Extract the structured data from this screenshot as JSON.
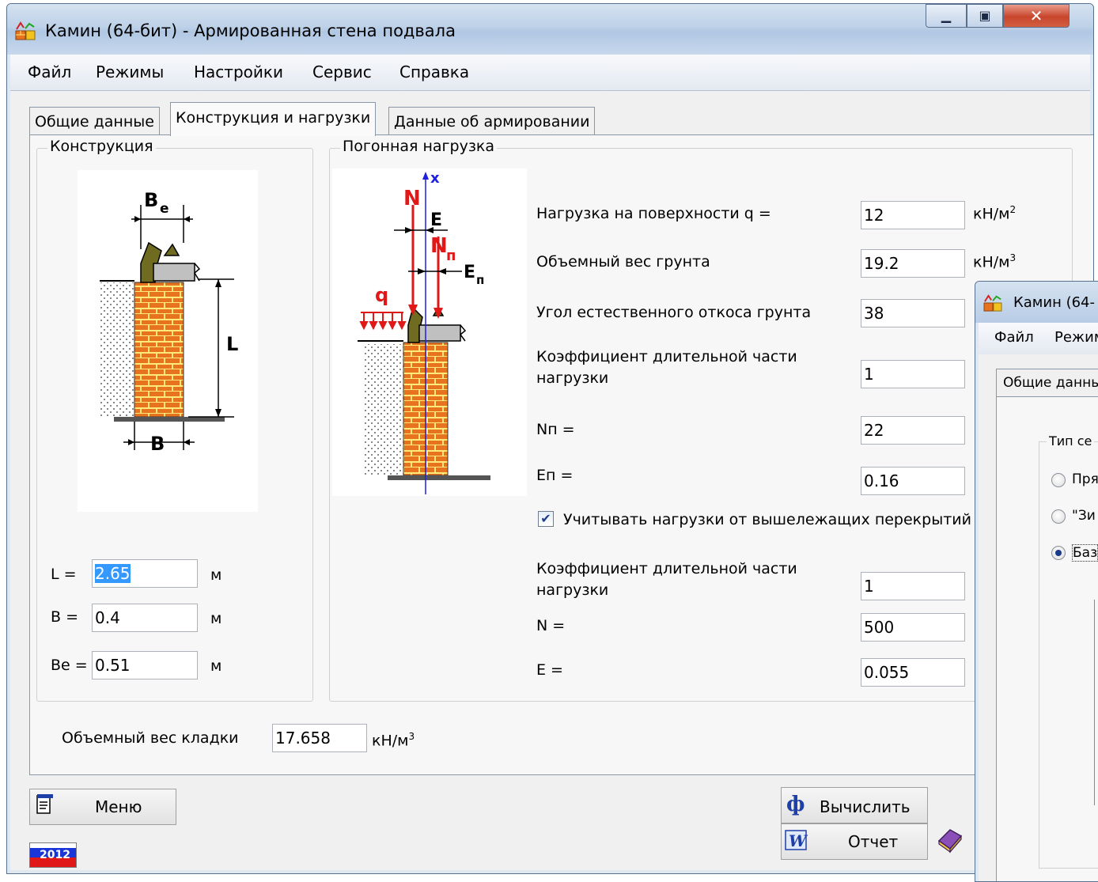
{
  "window": {
    "title": "Камин (64-бит) - Армированная стена подвала",
    "controls": [
      "minimize-icon",
      "maximize-icon",
      "close-icon"
    ]
  },
  "menu": [
    "Файл",
    "Режимы",
    "Настройки",
    "Сервис",
    "Справка"
  ],
  "tabs": [
    "Общие данные",
    "Конструкция и нагрузки",
    "Данные об армировании"
  ],
  "active_tab": "Конструкция и нагрузки",
  "construction": {
    "group_label": "Конструкция",
    "figure": {
      "Be": "B",
      "Be_sub": "e",
      "L": "L",
      "B": "B"
    },
    "fields": [
      {
        "label": "L =",
        "value": "2.65",
        "unit": "м"
      },
      {
        "label": "B =",
        "value": "0.4",
        "unit": "м"
      },
      {
        "label": "Be =",
        "value": "0.51",
        "unit": "м"
      }
    ]
  },
  "load": {
    "group_label": "Погонная нагрузка",
    "figure": {
      "x": "x",
      "N": "N",
      "E": "E",
      "Nn": "N",
      "Nn_sub": "п",
      "En": "E",
      "En_sub": "п",
      "q": "q"
    },
    "fields": [
      {
        "label": "Нагрузка на поверхности q =",
        "value": "12",
        "unit": "кН/м",
        "unit_sup": "2"
      },
      {
        "label": "Объемный вес грунта",
        "value": "19.2",
        "unit": "кН/м",
        "unit_sup": "3"
      },
      {
        "label": "Угол естественного откоса грунта",
        "value": "38"
      },
      {
        "label1": "Коэффициент длительной части",
        "label2": "нагрузки",
        "value": "1"
      },
      {
        "label": "Nп =",
        "value": "22"
      },
      {
        "label": "Eп =",
        "value": "0.16"
      }
    ],
    "checkbox": {
      "label": "Учитывать нагрузки от вышележащих перекрытий",
      "checked": true
    },
    "upper_fields": [
      {
        "label1": "Коэффициент длительной части",
        "label2": "нагрузки",
        "value": "1"
      },
      {
        "label": "N =",
        "value": "500"
      },
      {
        "label": "E =",
        "value": "0.055"
      }
    ]
  },
  "masonry": {
    "label": "Объемный вес кладки",
    "value": "17.658",
    "unit": "кН/м",
    "unit_sup": "3"
  },
  "buttons": {
    "menu": "Меню",
    "calculate": "Вычислить",
    "report": "Отчет"
  },
  "year_badge": "2012",
  "second_window": {
    "title": "Камин (64-",
    "menu": [
      "Файл",
      "Режим"
    ],
    "tab": "Общие данны",
    "group_label": "Тип се",
    "radios": [
      {
        "label": "Пря",
        "selected": false
      },
      {
        "label": "\"Зи",
        "selected": false
      },
      {
        "label": "Баз",
        "selected": true
      }
    ]
  },
  "colors": {
    "brick": "#e8731e",
    "mortar": "#ffe97a",
    "slab": "#6f6b20",
    "load_arrow": "#e01818",
    "axis": "#1f1fe0"
  }
}
